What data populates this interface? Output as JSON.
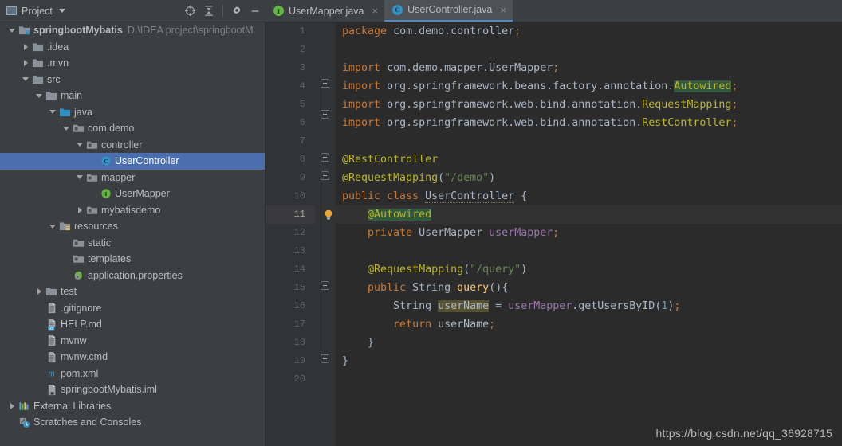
{
  "panel": {
    "title": "Project",
    "icon": "project-icon",
    "tools": [
      {
        "name": "locate-icon",
        "title": "Select Opened File"
      },
      {
        "name": "collapse-all-icon",
        "title": "Collapse All"
      },
      {
        "name": "gear-icon",
        "title": "Settings"
      },
      {
        "name": "minimize-icon",
        "title": "Hide"
      }
    ]
  },
  "tree": {
    "nodes": [
      {
        "label": "springbootMybatis",
        "path": "D:\\IDEA project\\springbootM",
        "indent": 0,
        "arrow": "down",
        "icon": "module-icon",
        "bold": true,
        "selected": false
      },
      {
        "label": ".idea",
        "path": "",
        "indent": 1,
        "arrow": "right",
        "icon": "folder-icon",
        "bold": false,
        "selected": false
      },
      {
        "label": ".mvn",
        "path": "",
        "indent": 1,
        "arrow": "right",
        "icon": "folder-icon",
        "bold": false,
        "selected": false
      },
      {
        "label": "src",
        "path": "",
        "indent": 1,
        "arrow": "down",
        "icon": "folder-icon",
        "bold": false,
        "selected": false
      },
      {
        "label": "main",
        "path": "",
        "indent": 2,
        "arrow": "down",
        "icon": "folder-icon",
        "bold": false,
        "selected": false
      },
      {
        "label": "java",
        "path": "",
        "indent": 3,
        "arrow": "down",
        "icon": "source-folder-icon",
        "bold": false,
        "selected": false
      },
      {
        "label": "com.demo",
        "path": "",
        "indent": 4,
        "arrow": "down",
        "icon": "package-icon",
        "bold": false,
        "selected": false
      },
      {
        "label": "controller",
        "path": "",
        "indent": 5,
        "arrow": "down",
        "icon": "package-icon",
        "bold": false,
        "selected": false
      },
      {
        "label": "UserController",
        "path": "",
        "indent": 6,
        "arrow": "none",
        "icon": "java-class-icon",
        "bold": false,
        "selected": true
      },
      {
        "label": "mapper",
        "path": "",
        "indent": 5,
        "arrow": "down",
        "icon": "package-icon",
        "bold": false,
        "selected": false
      },
      {
        "label": "UserMapper",
        "path": "",
        "indent": 6,
        "arrow": "none",
        "icon": "java-interface-icon",
        "bold": false,
        "selected": false
      },
      {
        "label": "mybatisdemo",
        "path": "",
        "indent": 5,
        "arrow": "right",
        "icon": "package-icon",
        "bold": false,
        "selected": false
      },
      {
        "label": "resources",
        "path": "",
        "indent": 3,
        "arrow": "down",
        "icon": "resources-folder-icon",
        "bold": false,
        "selected": false
      },
      {
        "label": "static",
        "path": "",
        "indent": 4,
        "arrow": "none",
        "icon": "package-icon",
        "bold": false,
        "selected": false
      },
      {
        "label": "templates",
        "path": "",
        "indent": 4,
        "arrow": "none",
        "icon": "package-icon",
        "bold": false,
        "selected": false
      },
      {
        "label": "application.properties",
        "path": "",
        "indent": 4,
        "arrow": "none",
        "icon": "spring-properties-icon",
        "bold": false,
        "selected": false
      },
      {
        "label": "test",
        "path": "",
        "indent": 2,
        "arrow": "right",
        "icon": "folder-icon",
        "bold": false,
        "selected": false
      },
      {
        "label": ".gitignore",
        "path": "",
        "indent": 2,
        "arrow": "none",
        "icon": "text-file-icon",
        "bold": false,
        "selected": false
      },
      {
        "label": "HELP.md",
        "path": "",
        "indent": 2,
        "arrow": "none",
        "icon": "markdown-file-icon",
        "bold": false,
        "selected": false
      },
      {
        "label": "mvnw",
        "path": "",
        "indent": 2,
        "arrow": "none",
        "icon": "text-file-icon",
        "bold": false,
        "selected": false
      },
      {
        "label": "mvnw.cmd",
        "path": "",
        "indent": 2,
        "arrow": "none",
        "icon": "text-file-icon",
        "bold": false,
        "selected": false
      },
      {
        "label": "pom.xml",
        "path": "",
        "indent": 2,
        "arrow": "none",
        "icon": "maven-file-icon",
        "bold": false,
        "selected": false
      },
      {
        "label": "springbootMybatis.iml",
        "path": "",
        "indent": 2,
        "arrow": "none",
        "icon": "iml-file-icon",
        "bold": false,
        "selected": false
      },
      {
        "label": "External Libraries",
        "path": "",
        "indent": 0,
        "arrow": "right",
        "icon": "libraries-icon",
        "bold": false,
        "selected": false
      },
      {
        "label": "Scratches and Consoles",
        "path": "",
        "indent": 0,
        "arrow": "none",
        "icon": "scratches-icon",
        "bold": false,
        "selected": false
      }
    ]
  },
  "tabs": [
    {
      "label": "UserMapper.java",
      "icon": "java-interface-icon",
      "active": false,
      "close": "×"
    },
    {
      "label": "UserController.java",
      "icon": "java-class-icon",
      "active": true,
      "close": "×"
    }
  ],
  "editor": {
    "line_numbers": [
      "1",
      "2",
      "3",
      "4",
      "5",
      "6",
      "7",
      "8",
      "9",
      "10",
      "11",
      "12",
      "13",
      "14",
      "15",
      "16",
      "17",
      "18",
      "19",
      "20"
    ],
    "current_line": 11,
    "code_lines": [
      "package com.demo.controller;",
      "",
      "import com.demo.mapper.UserMapper;",
      "import org.springframework.beans.factory.annotation.Autowired;",
      "import org.springframework.web.bind.annotation.RequestMapping;",
      "import org.springframework.web.bind.annotation.RestController;",
      "",
      "@RestController",
      "@RequestMapping(\"/demo\")",
      "public class UserController {",
      "    @Autowired",
      "    private UserMapper userMapper;",
      "",
      "    @RequestMapping(\"/query\")",
      "    public String query(){",
      "        String userName = userMapper.getUsersByID(1);",
      "        return userName;",
      "    }",
      "}",
      ""
    ],
    "gutter_icons": [
      {
        "line": 11,
        "name": "intention-bulb-icon"
      }
    ]
  },
  "watermark": "https://blog.csdn.net/qq_36928715",
  "colors": {
    "selection": "#4b6eaf",
    "panel_bg": "#3c3f41",
    "editor_bg": "#2b2b2b",
    "gutter_bg": "#313335",
    "keyword": "#cc7832",
    "string": "#6a8759",
    "annotation": "#bbb529",
    "field": "#9876aa",
    "method": "#ffc66d",
    "number": "#6897bb",
    "text": "#a9b7c6",
    "tab_underline": "#4a88c7"
  }
}
